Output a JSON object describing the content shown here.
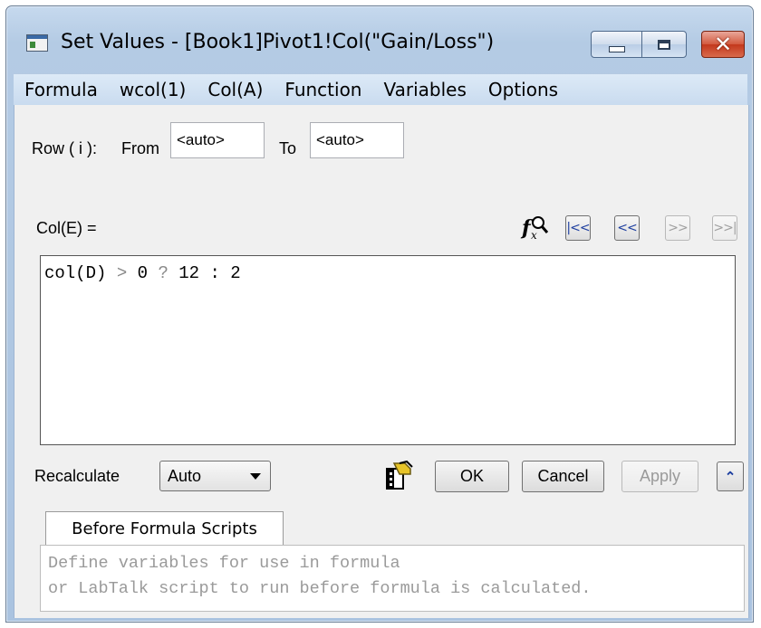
{
  "window": {
    "title": "Set Values - [Book1]Pivot1!Col(\"Gain/Loss\")",
    "icon": "app-window-icon",
    "controls": {
      "minimize": "minimize-icon",
      "maximize": "maximize-icon",
      "close_glyph": "✕"
    }
  },
  "menu": [
    "Formula",
    "wcol(1)",
    "Col(A)",
    "Function",
    "Variables",
    "Options"
  ],
  "rows": {
    "label": "Row ( i ):",
    "from_label": "From",
    "from_value": "<auto>",
    "to_label": "To",
    "to_value": "<auto>"
  },
  "formula": {
    "target_label": "Col(E) =",
    "tokens": [
      {
        "text": "col(D) ",
        "kind": "code"
      },
      {
        "text": "> ",
        "kind": "op"
      },
      {
        "text": "0 ",
        "kind": "code"
      },
      {
        "text": "? ",
        "kind": "op"
      },
      {
        "text": "12 : 2",
        "kind": "code"
      }
    ],
    "nav_buttons": [
      {
        "label": "|<<",
        "enabled": true,
        "name": "first-column-button"
      },
      {
        "label": "<<",
        "enabled": true,
        "name": "previous-column-button"
      },
      {
        "label": ">>",
        "enabled": false,
        "name": "next-column-button"
      },
      {
        "label": ">>|",
        "enabled": false,
        "name": "last-column-button"
      }
    ]
  },
  "recalculate": {
    "label": "Recalculate",
    "value": "Auto"
  },
  "buttons": {
    "ok": "OK",
    "cancel": "Cancel",
    "apply": "Apply"
  },
  "script_tab": {
    "label": "Before Formula Scripts",
    "placeholder_lines": [
      "Define variables for use in formula",
      "or LabTalk script to run before formula is calculated."
    ]
  }
}
